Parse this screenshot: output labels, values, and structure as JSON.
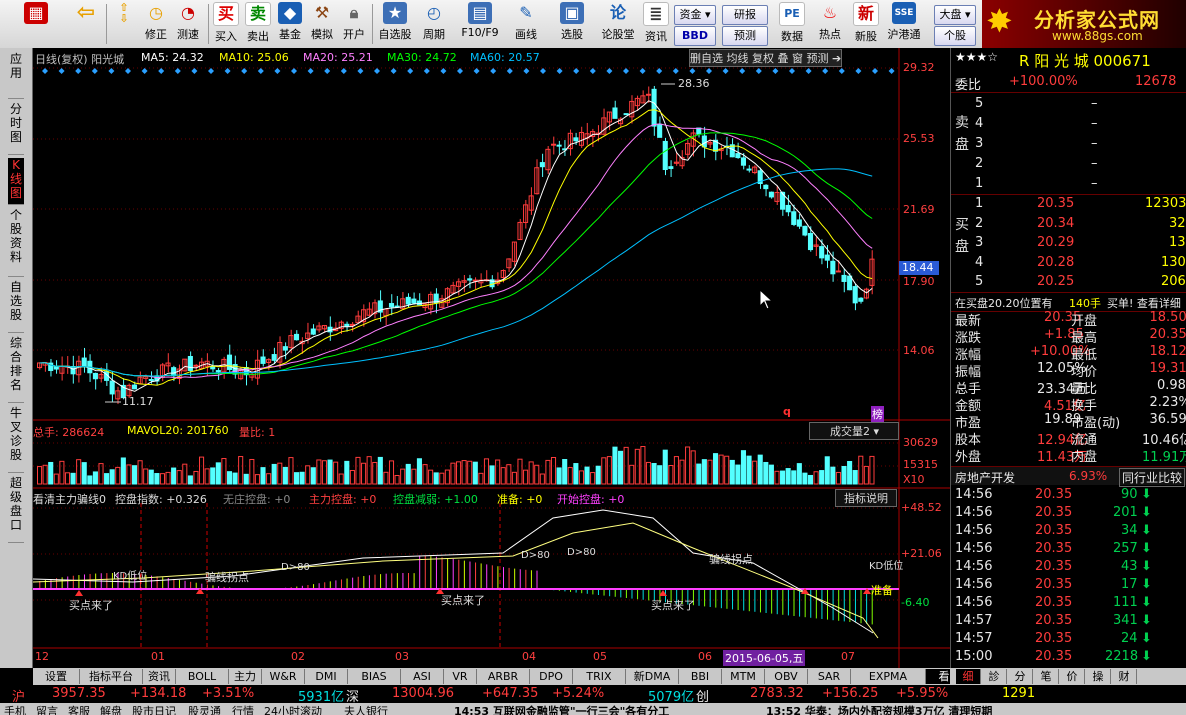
{
  "toolbar": {
    "buttons": [
      "",
      "",
      "修正",
      "测速",
      "买入",
      "卖出",
      "基金",
      "模拟",
      "开户",
      "自选股",
      "周期",
      "F10/F9",
      "画线",
      "选股",
      "论股堂",
      "资讯",
      "数据",
      "热点",
      "新股",
      "沪港通",
      "个股"
    ],
    "top_buttons": {
      "zijin": "资金",
      "yanbao": "研报",
      "bbd": "BBD",
      "yuce": "预测",
      "dapan": "大盘"
    },
    "logo_title": "分析家公式网",
    "logo_url": "www.88gs.com"
  },
  "left_tabs": [
    "应用",
    "分时图",
    "K线图",
    "个股资料",
    "自选股",
    "综合排名",
    "牛叉诊股",
    "超级盘口"
  ],
  "chart": {
    "title_stock": "日线(复权) 阳光城",
    "ma5": "MA5: 24.32",
    "ma10": "MA10: 25.06",
    "ma20": "MA20: 25.21",
    "ma30": "MA30: 24.72",
    "ma60": "MA60: 20.57",
    "menu": [
      "删自选",
      "均线",
      "复权",
      "叠",
      "窗",
      "预测"
    ],
    "price_ticks": [
      "29.32",
      "25.53",
      "21.69",
      "17.90",
      "14.06"
    ],
    "current_price_tag": "18.44",
    "high_label": "28.36",
    "low_label": "11.17",
    "marker_q": "q",
    "marker_rank": "榜",
    "vol_header": {
      "total": "总手: 286624",
      "mavol": "MAVOL20: 201760",
      "ratio": "量比: 1"
    },
    "vol_selector": "成交量2",
    "vol_ticks": [
      "30629",
      "15315",
      "X10"
    ],
    "ind_header": {
      "name": "看清主力骗线0",
      "ctrl": "控盘指数: +0.326",
      "nozk": "无庄控盘: +0",
      "main": "主力控盘: +0",
      "weak": "控盘减弱: +1.00",
      "ready": "准备: +0",
      "start": "开始控盘: +0"
    },
    "ind_btn": "指标说明",
    "ind_ticks": [
      "+48.52",
      "+21.06",
      "-6.40"
    ],
    "ind_annotations": {
      "buy1": "买点来了",
      "buy2": "买点来了",
      "buy3": "买点来了",
      "lie1": "骗线拐点",
      "lie2": "骗线拐点",
      "kd1": "KD低位",
      "kd2": "KD低位",
      "d80a": "D>80",
      "d80b": "D>80",
      "d80c": "D>80",
      "ready": "准备"
    },
    "x_ticks": [
      "12",
      "01",
      "02",
      "03",
      "04",
      "05",
      "06",
      "07"
    ],
    "x_cursor_date": "2015-06-05,五"
  },
  "chart_data": {
    "type": "candlestick",
    "title": "日线(复权) 阳光城",
    "ylim": [
      11.17,
      29.32
    ],
    "high": 28.36,
    "low": 11.17,
    "last": 18.44
  },
  "right_panel": {
    "stock_title": "R 阳 光 城 000671",
    "weibi_label": "委比",
    "weibi_value": "+100.00%",
    "weibi_diff": "12678",
    "sell_label": "卖盘",
    "sells": [
      {
        "n": "5",
        "p": "–",
        "v": ""
      },
      {
        "n": "4",
        "p": "–",
        "v": ""
      },
      {
        "n": "3",
        "p": "–",
        "v": ""
      },
      {
        "n": "2",
        "p": "–",
        "v": ""
      },
      {
        "n": "1",
        "p": "–",
        "v": ""
      }
    ],
    "buy_label": "买盘",
    "buys": [
      {
        "n": "1",
        "p": "20.35",
        "v": "12303"
      },
      {
        "n": "2",
        "p": "20.34",
        "v": "32"
      },
      {
        "n": "3",
        "p": "20.29",
        "v": "13"
      },
      {
        "n": "4",
        "p": "20.28",
        "v": "130"
      },
      {
        "n": "5",
        "p": "20.25",
        "v": "206"
      }
    ],
    "info_line": "在买盘20.20位置有",
    "info_vol": "140手",
    "info_tail": "买单! 查看详细",
    "quote": [
      {
        "l1": "最新",
        "v1": "20.35",
        "l2": "开盘",
        "v2": "18.50"
      },
      {
        "l1": "涨跌",
        "v1": "+1.85",
        "l2": "最高",
        "v2": "20.35"
      },
      {
        "l1": "涨幅",
        "v1": "+10.00%",
        "l2": "最低",
        "v2": "18.12"
      },
      {
        "l1": "振幅",
        "v1": "12.05%",
        "l2": "均价",
        "v2": "19.31"
      },
      {
        "l1": "总手",
        "v1": "23.34万",
        "l2": "量比",
        "v2": "0.98"
      },
      {
        "l1": "金额",
        "v1": "4.51亿",
        "l2": "换手",
        "v2": "2.23%"
      },
      {
        "l1": "市盈",
        "v1": "19.89",
        "l2": "市盈(动)",
        "v2": "36.59"
      },
      {
        "l1": "股本",
        "v1": "12.94亿",
        "l2": "流通",
        "v2": "10.46亿"
      },
      {
        "l1": "外盘",
        "v1": "11.43万",
        "l2": "内盘",
        "v2": "11.91万"
      }
    ],
    "industry": "房地产开发",
    "industry_pct": "6.93%",
    "industry_btn": "同行业比较",
    "ticks": [
      {
        "t": "14:56",
        "p": "20.35",
        "v": "90"
      },
      {
        "t": "14:56",
        "p": "20.35",
        "v": "201"
      },
      {
        "t": "14:56",
        "p": "20.35",
        "v": "34"
      },
      {
        "t": "14:56",
        "p": "20.35",
        "v": "257"
      },
      {
        "t": "14:56",
        "p": "20.35",
        "v": "43"
      },
      {
        "t": "14:56",
        "p": "20.35",
        "v": "17"
      },
      {
        "t": "14:56",
        "p": "20.35",
        "v": "111"
      },
      {
        "t": "14:57",
        "p": "20.35",
        "v": "341"
      },
      {
        "t": "14:57",
        "p": "20.35",
        "v": "24"
      },
      {
        "t": "15:00",
        "p": "20.35",
        "v": "2218"
      }
    ]
  },
  "bottom_tabs": [
    "设置",
    "指标平台",
    "资讯",
    "BOLL",
    "主力",
    "W&R",
    "DMI",
    "BIAS",
    "ASI",
    "VR",
    "ARBR",
    "DPO",
    "TRIX",
    "新DMA",
    "BBI",
    "MTM",
    "OBV",
    "SAR",
    "EXPMA",
    "看清主力骗线0"
  ],
  "right_bottom_tabs": [
    "细",
    "診",
    "分",
    "笔",
    "价",
    "操",
    "财"
  ],
  "status": {
    "sh_label": "沪",
    "sh_val": "3957.35",
    "sh_chg": "+134.18",
    "sh_pct": "+3.51%",
    "sh_amt": "5931亿",
    "sz_label": "深",
    "sz_val": "13004.96",
    "sz_chg": "+647.35",
    "sz_pct": "+5.24%",
    "sz_amt": "5079亿",
    "cy_label": "创",
    "cy_val": "2783.32",
    "cy_chg": "+156.25",
    "cy_pct": "+5.95%",
    "tail": "1291"
  },
  "status2": {
    "items": [
      "手机",
      "留言",
      "客服",
      "解盘",
      "股市日记",
      "股灵通",
      "行情",
      "24小时滚动",
      "夫人银行"
    ],
    "news1": "14:53 互联网金融监管\"一行三会\"各有分工",
    "news2": "13:52 华泰：场内外配资规模3万亿 清理短期"
  },
  "colors": {
    "up": "#ff3c3c",
    "down": "#54ffff",
    "ma5": "#ffffff",
    "ma10": "#ffff00",
    "ma20": "#ff80ff",
    "ma30": "#00ff00",
    "ma60": "#00c0ff"
  }
}
